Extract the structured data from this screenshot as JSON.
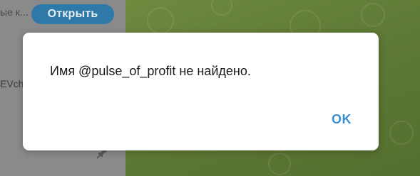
{
  "sidebar": {
    "top_text": "ые к...",
    "open_label": "Открыть",
    "partial_text": "EVch",
    "pin_icon": "pin-icon"
  },
  "dialog": {
    "message": "Имя @pulse_of_profit не найдено.",
    "ok_label": "OK"
  },
  "colors": {
    "accent": "#3a8fd0",
    "open_button": "#2f79a8",
    "overlay_sidebar": "#8a8a8a",
    "wallpaper": "#5f7a35"
  }
}
